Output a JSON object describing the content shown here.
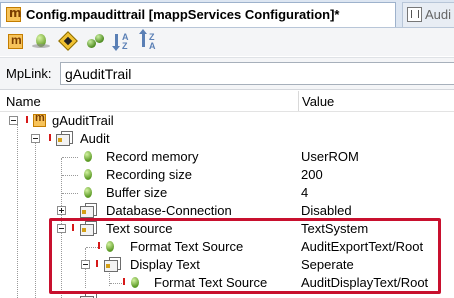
{
  "tabs": [
    {
      "label": "Config.mpaudittrail [mappServices Configuration]*",
      "icon": "mapp-config-icon",
      "active": true
    },
    {
      "label": "Audi",
      "icon": "document-icon",
      "active": false
    }
  ],
  "toolbar": {
    "buttons": [
      {
        "icon": "mapp-config-icon"
      },
      {
        "icon": "green-pin-icon"
      },
      {
        "icon": "diamond-icon"
      },
      {
        "icon": "double-pin-icon"
      },
      {
        "icon": "sort-ascending-icon",
        "letters": [
          "A",
          "Z"
        ]
      },
      {
        "icon": "sort-descending-icon",
        "letters": [
          "Z",
          "A"
        ]
      }
    ]
  },
  "mplink": {
    "label": "MpLink:",
    "value": "gAuditTrail"
  },
  "columns": {
    "name": "Name",
    "value": "Value"
  },
  "tree": [
    {
      "label": "gAuditTrail",
      "value": ""
    },
    {
      "label": "Audit",
      "value": ""
    },
    {
      "label": "Record memory",
      "value": "UserROM"
    },
    {
      "label": "Recording size",
      "value": "200"
    },
    {
      "label": "Buffer size",
      "value": "4"
    },
    {
      "label": "Database-Connection",
      "value": "Disabled"
    },
    {
      "label": "Text source",
      "value": "TextSystem"
    },
    {
      "label": "Format Text Source",
      "value": "AuditExportText/Root"
    },
    {
      "label": "Display Text",
      "value": "Seperate"
    },
    {
      "label": "Format Text Source",
      "value": "AuditDisplayText/Root"
    }
  ],
  "colors": {
    "highlight": "#c8102e",
    "error_marker": "#d61919",
    "accent": "#f7c35a"
  }
}
